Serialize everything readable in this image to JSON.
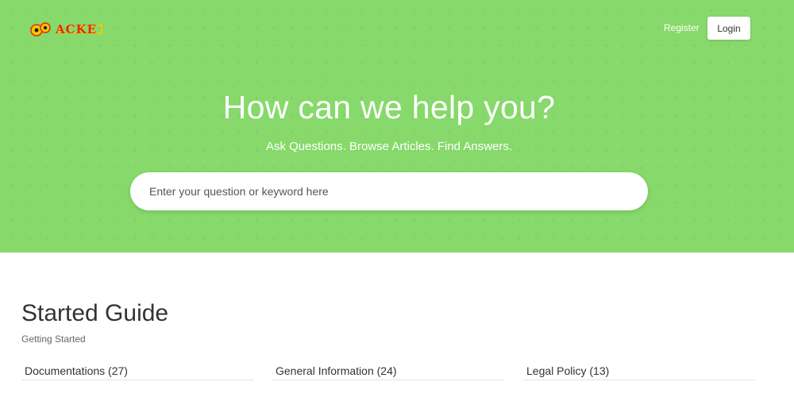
{
  "header": {
    "logo_text": "ACKE",
    "register_label": "Register",
    "login_label": "Login"
  },
  "hero": {
    "title": "How can we help you?",
    "subtitle": "Ask Questions. Browse Articles. Find Answers.",
    "search_placeholder": "Enter your question or keyword here"
  },
  "section": {
    "title": "Started Guide",
    "subtitle": "Getting Started",
    "categories": [
      {
        "label": "Documentations (27)"
      },
      {
        "label": "General Information (24)"
      },
      {
        "label": "Legal Policy (13)"
      }
    ]
  },
  "colors": {
    "hero_background": "#86d96a",
    "logo_red": "#e62a12",
    "logo_yellow": "#f7c800"
  }
}
